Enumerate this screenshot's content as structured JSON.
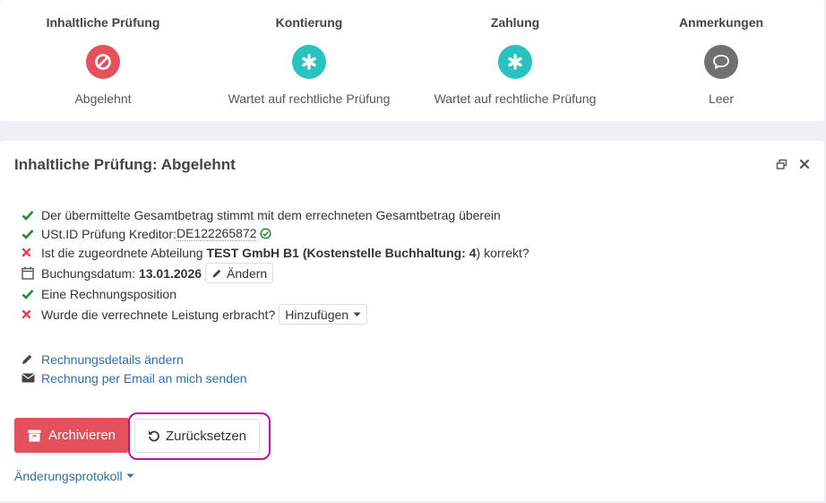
{
  "steps": [
    {
      "title": "Inhaltliche Prüfung",
      "status": "Abgelehnt",
      "icon": "ban-icon",
      "color": "#e4515d"
    },
    {
      "title": "Kontierung",
      "status": "Wartet auf rechtliche Prüfung",
      "icon": "asterisk-icon",
      "color": "#28c3c0"
    },
    {
      "title": "Zahlung",
      "status": "Wartet auf rechtliche Prüfung",
      "icon": "asterisk-icon",
      "color": "#28c3c0"
    },
    {
      "title": "Anmerkungen",
      "status": "Leer",
      "icon": "comment-icon",
      "color": "#707070"
    }
  ],
  "panel": {
    "title": "Inhaltliche Prüfung: Abgelehnt"
  },
  "checks": {
    "total_match": "Der übermittelte Gesamtbetrag stimmt mit dem errechneten Gesamtbetrag überein",
    "vat_label": "USt.ID Prüfung Kreditor: ",
    "vat_id": "DE122265872",
    "dept_prefix": "Ist die zugeordnete Abteilung ",
    "dept_name": "TEST GmbH B1",
    "dept_paren_open": " (",
    "cost_center": "Kostenstelle Buchhaltung: 4",
    "dept_suffix": ") korrekt?",
    "booking_label": "Buchungsdatum: ",
    "booking_date": "13.01.2026",
    "change_label": "Ändern",
    "position": "Eine Rechnungsposition",
    "service_question": "Wurde die verrechnete Leistung erbracht?",
    "add_label": "Hinzufügen"
  },
  "links": {
    "edit_details": "Rechnungsdetails ändern",
    "send_email": "Rechnung per Email an mich senden"
  },
  "actions": {
    "archive": "Archivieren",
    "reset": "Zurücksetzen",
    "changelog": "Änderungsprotokoll"
  },
  "colors": {
    "success": "#1d8a2f",
    "error": "#e4424f",
    "link": "#2f6eb0",
    "archive_button": "#e4515d",
    "highlight": "#c40f9a"
  }
}
